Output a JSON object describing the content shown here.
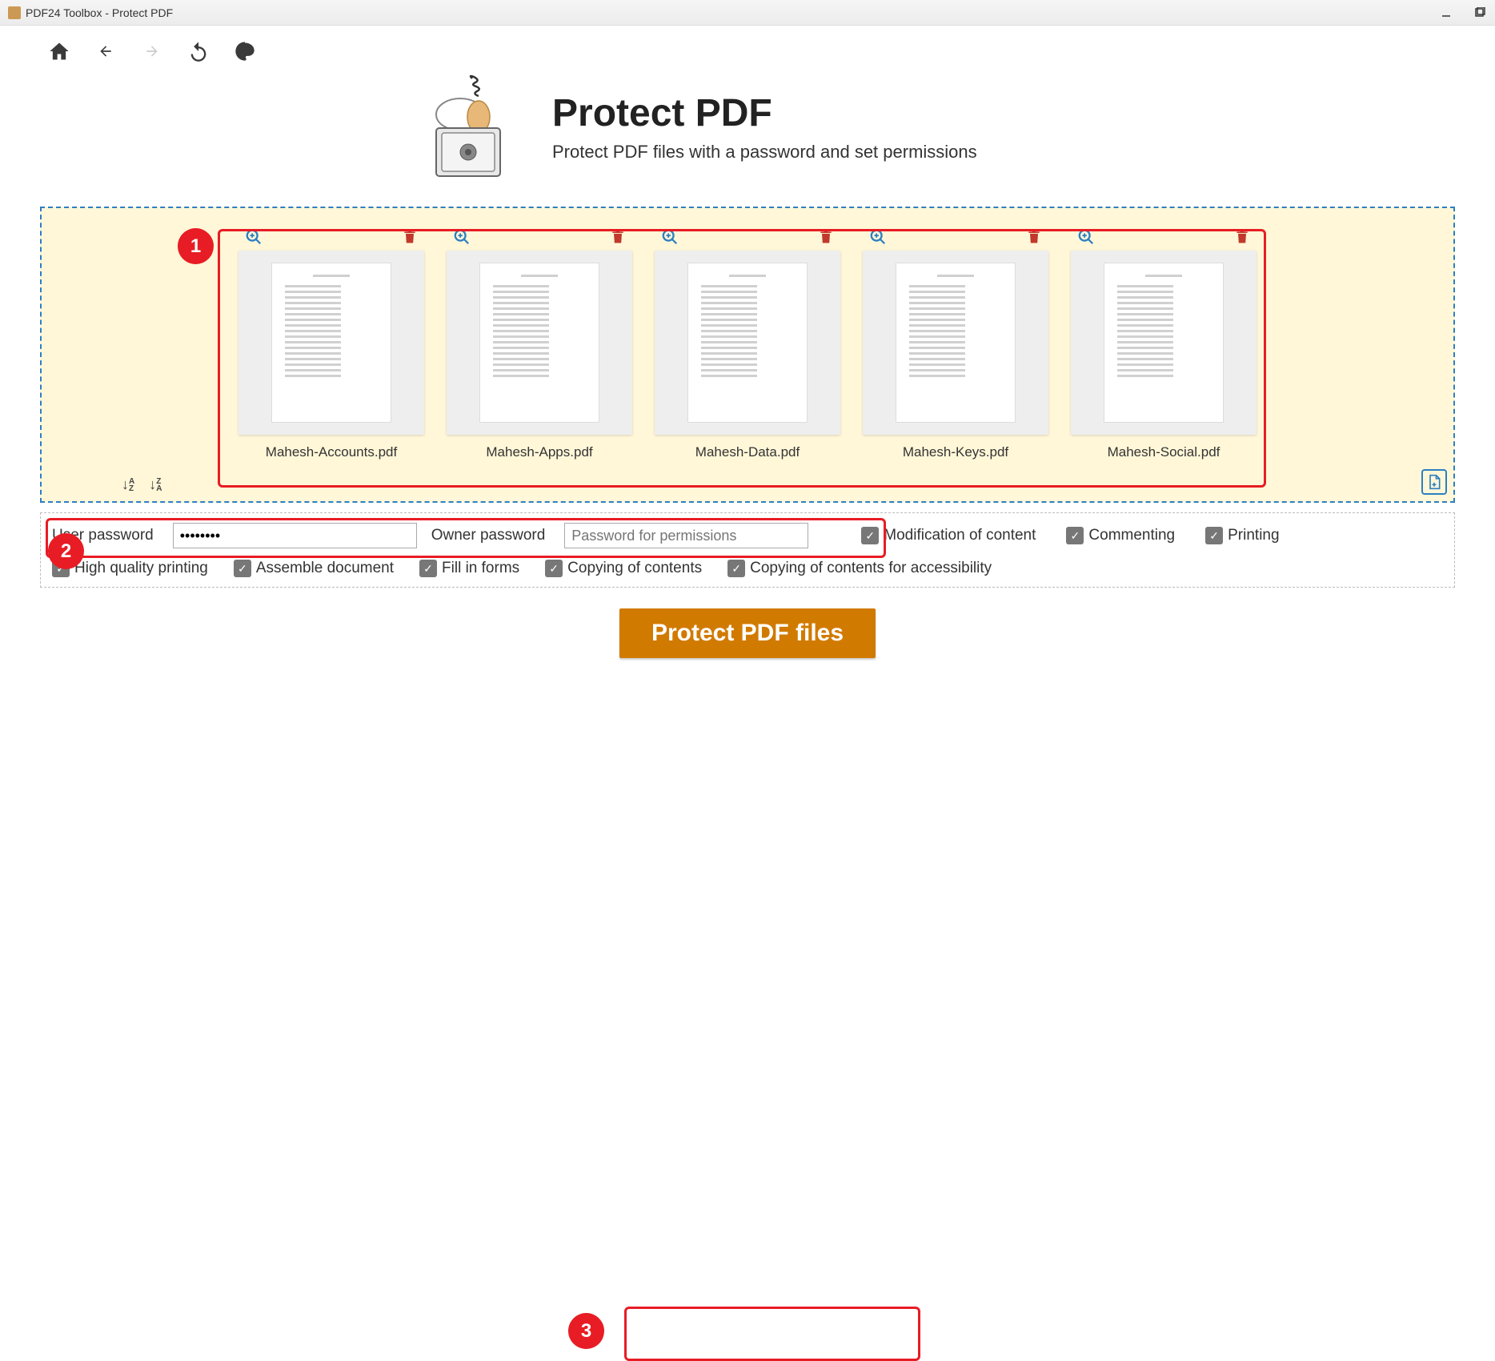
{
  "window": {
    "title": "PDF24 Toolbox - Protect PDF"
  },
  "header": {
    "title": "Protect PDF",
    "subtitle": "Protect PDF files with a password and set permissions"
  },
  "files": [
    {
      "name": "Mahesh-Accounts.pdf"
    },
    {
      "name": "Mahesh-Apps.pdf"
    },
    {
      "name": "Mahesh-Data.pdf"
    },
    {
      "name": "Mahesh-Keys.pdf"
    },
    {
      "name": "Mahesh-Social.pdf"
    }
  ],
  "passwords": {
    "user_label": "User password",
    "user_value": "••••••••",
    "owner_label": "Owner password",
    "owner_placeholder": "Password for permissions"
  },
  "permissions": {
    "row1": [
      {
        "label": "Modification of content",
        "checked": true
      },
      {
        "label": "Commenting",
        "checked": true
      },
      {
        "label": "Printing",
        "checked": true
      }
    ],
    "row2": [
      {
        "label": "High quality printing",
        "checked": true
      },
      {
        "label": "Assemble document",
        "checked": true
      },
      {
        "label": "Fill in forms",
        "checked": true
      },
      {
        "label": "Copying of contents",
        "checked": true
      },
      {
        "label": "Copying of contents for accessibility",
        "checked": true
      }
    ]
  },
  "action": {
    "label": "Protect PDF files"
  },
  "annotations": {
    "m1": "1",
    "m2": "2",
    "m3": "3"
  }
}
